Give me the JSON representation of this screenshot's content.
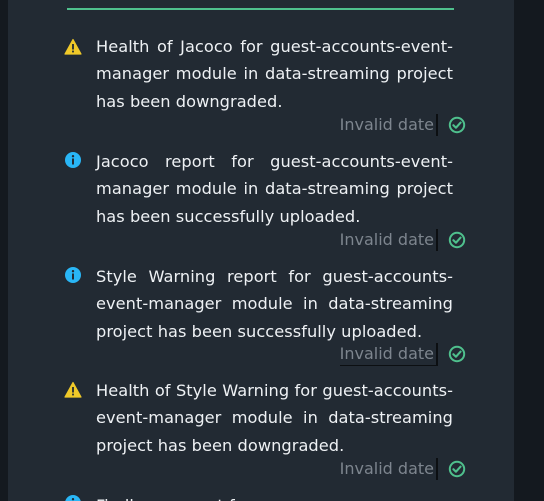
{
  "notifications": [
    {
      "type": "warning",
      "icon": "warning-icon",
      "message": "Health of Jacoco for guest-accounts-event-manager module in data-streaming project has been downgraded.",
      "date": "Invalid date"
    },
    {
      "type": "info",
      "icon": "info-icon",
      "message": "Jacoco report for guest-accounts-event-manager module in data-streaming project has been successfully uploaded.",
      "date": "Invalid date"
    },
    {
      "type": "info",
      "icon": "info-icon",
      "message": "Style Warning report for guest-accounts-event-manager module in data-streaming project has been successfully uploaded.",
      "date": "Invalid date"
    },
    {
      "type": "warning",
      "icon": "warning-icon",
      "message": "Health of Style Warning for guest-accounts-event-manager module in data-streaming project has been downgraded.",
      "date": "Invalid date"
    },
    {
      "type": "info",
      "icon": "info-icon",
      "message": "Findbugs report for",
      "date": ""
    }
  ],
  "colors": {
    "accent": "#4fc08d",
    "warning": "#f0c929",
    "info": "#29b6f6",
    "panel": "#222a33",
    "background": "#14191f",
    "text": "#eef1f4",
    "muted": "#7d858e"
  }
}
